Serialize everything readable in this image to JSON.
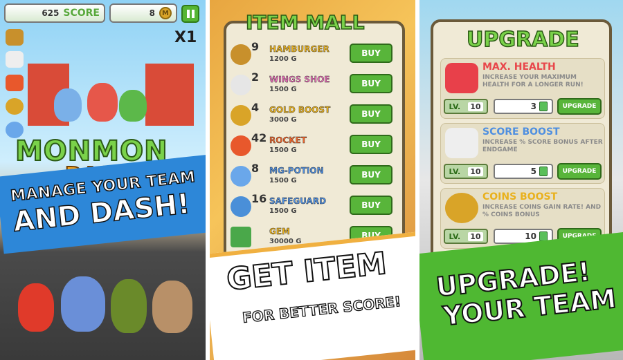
{
  "screen1": {
    "score_value": "625",
    "score_label": "SCORE",
    "coins_value": "8",
    "coin_glyph": "M",
    "multiplier": "X1",
    "logo_top": "MONMON",
    "logo_bottom": "DASH",
    "banner_line1": "MANAGE YOUR TEAM",
    "banner_line2": "AND DASH!"
  },
  "screen2": {
    "title": "ITEM MALL",
    "items": [
      {
        "qty": "9",
        "name": "HAMBURGER",
        "price": "1200 G",
        "buy": "BUY",
        "color": "#c8902c",
        "name_color": "#e9b11d"
      },
      {
        "qty": "2",
        "name": "WINGS SHOE",
        "price": "1500 G",
        "buy": "BUY",
        "color": "#e6e6e6",
        "name_color": "#e872b9"
      },
      {
        "qty": "4",
        "name": "GOLD BOOST",
        "price": "3000 G",
        "buy": "BUY",
        "color": "#d9a428",
        "name_color": "#e9b11d"
      },
      {
        "qty": "42",
        "name": "ROCKET",
        "price": "1500 G",
        "buy": "BUY",
        "color": "#e8582c",
        "name_color": "#f0662c"
      },
      {
        "qty": "8",
        "name": "MG-POTION",
        "price": "1500 G",
        "buy": "BUY",
        "color": "#6aa7ea",
        "name_color": "#4f8fe0"
      },
      {
        "qty": "16",
        "name": "SAFEGUARD",
        "price": "1500 G",
        "buy": "BUY",
        "color": "#4a8fd8",
        "name_color": "#4f8fe0"
      },
      {
        "qty": "",
        "name": "GEM",
        "price": "30000 G",
        "buy": "BUY",
        "color": "#4aa84a",
        "name_color": "#e9b11d"
      }
    ],
    "banner_line1": "GET ITEM",
    "banner_line2": "FOR BETTER SCORE!"
  },
  "screen3": {
    "title": "UPGRADE",
    "cards": [
      {
        "name": "MAX. HEALTH",
        "desc": "INCREASE YOUR MAXIMUM HEALTH FOR A LONGER RUN!",
        "lv_label": "LV.",
        "lv_value": "10",
        "cost": "3",
        "button": "UPGRADE",
        "color": "#e8404a",
        "name_color": "#e8464a"
      },
      {
        "name": "SCORE BOOST",
        "desc": "INCREASE % SCORE BONUS AFTER ENDGAME",
        "lv_label": "LV.",
        "lv_value": "10",
        "cost": "5",
        "button": "UPGRADE",
        "color": "#e6e6e6",
        "name_color": "#4f8fe0"
      },
      {
        "name": "COINS BOOST",
        "desc": "INCREASE COINS GAIN RATE! AND % COINS BONUS",
        "lv_label": "LV.",
        "lv_value": "10",
        "cost": "10",
        "button": "UPGRADE",
        "color": "#d9a428",
        "name_color": "#e9b11d"
      }
    ],
    "banner_line1": "UPGRADE!",
    "banner_line2": "YOUR TEAM"
  }
}
